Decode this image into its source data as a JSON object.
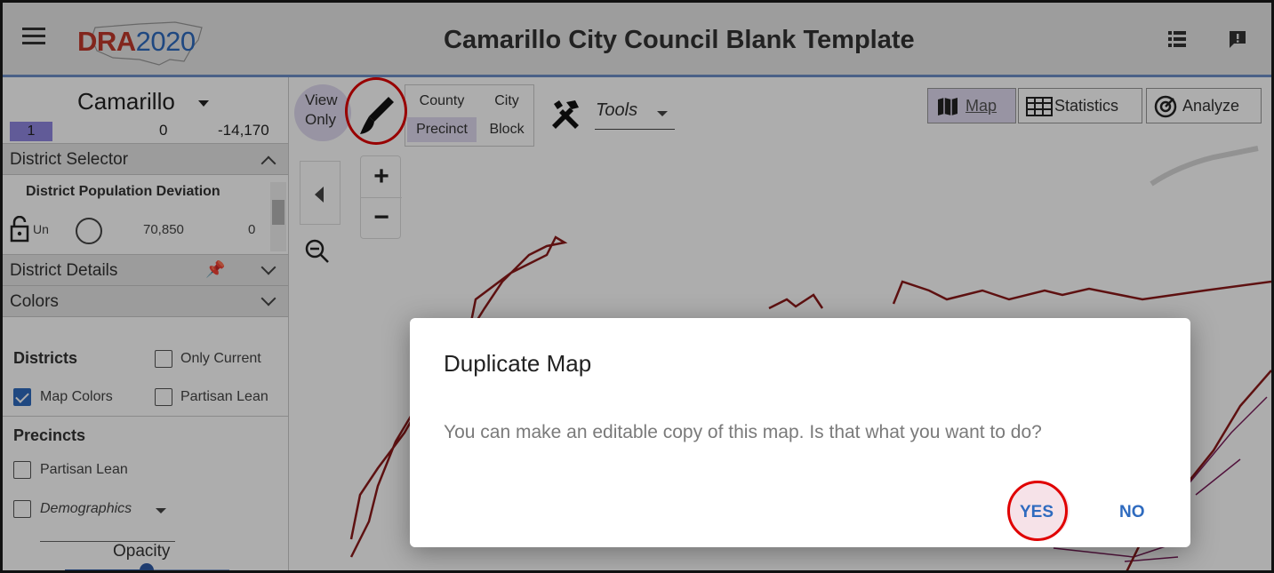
{
  "app": {
    "logo_primary": "DRA",
    "logo_secondary": "2020",
    "title": "Camarillo City Council Blank Template"
  },
  "topbar_icons": [
    "list-icon",
    "feedback-icon"
  ],
  "sidebar": {
    "place": "Camarillo",
    "district_number": "1",
    "district_value": "0",
    "district_deviation": "-14,170",
    "district_selector": {
      "label": "District Selector",
      "table_title": "District Population Deviation",
      "row": {
        "lock_label": "Un",
        "population": "70,850",
        "deviation": "0"
      }
    },
    "district_details": {
      "label": "District Details"
    },
    "colors": {
      "label": "Colors",
      "districts_heading": "Districts",
      "only_current": "Only Current",
      "map_colors": "Map Colors",
      "partisan_lean": "Partisan Lean",
      "precincts_heading": "Precincts",
      "precinct_partisan_lean": "Partisan Lean",
      "demographics": "Demographics",
      "opacity": "Opacity",
      "map_colors_checked": true
    }
  },
  "toolbar": {
    "view_line1": "View",
    "view_line2": "Only",
    "granularity": {
      "county": "County",
      "city": "City",
      "precinct": "Precinct",
      "block": "Block",
      "selected": "Precinct"
    },
    "tools_label": "Tools",
    "tabs": {
      "map": "Map",
      "statistics": "Statistics",
      "analyze": "Analyze"
    }
  },
  "dialog": {
    "title": "Duplicate Map",
    "message": "You can make an editable copy of this map. Is that what you want to do?",
    "yes": "YES",
    "no": "NO"
  },
  "colors": {
    "accent": "#2f6bbf",
    "district_chip": "#8f86e0",
    "highlight_ring": "#e00000",
    "district_outline": "#8b1a1a"
  }
}
